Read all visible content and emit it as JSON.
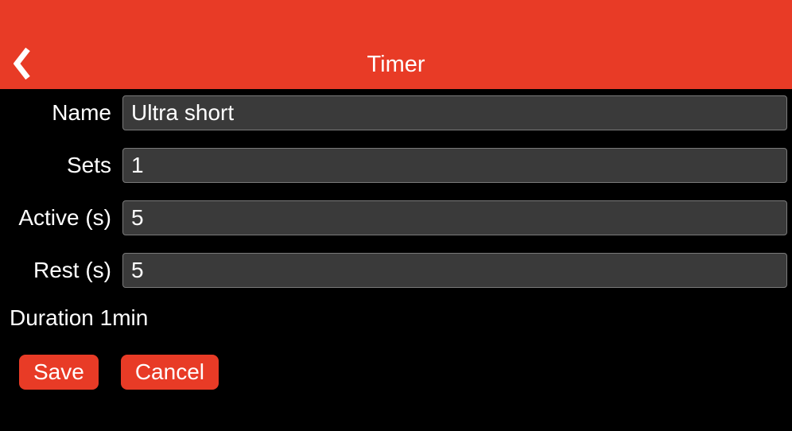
{
  "header": {
    "title": "Timer"
  },
  "form": {
    "name": {
      "label": "Name",
      "value": "Ultra short"
    },
    "sets": {
      "label": "Sets",
      "value": "1"
    },
    "active": {
      "label": "Active (s)",
      "value": "5"
    },
    "rest": {
      "label": "Rest (s)",
      "value": "5"
    }
  },
  "duration": {
    "label": "Duration",
    "value": "1min"
  },
  "buttons": {
    "save": "Save",
    "cancel": "Cancel"
  }
}
